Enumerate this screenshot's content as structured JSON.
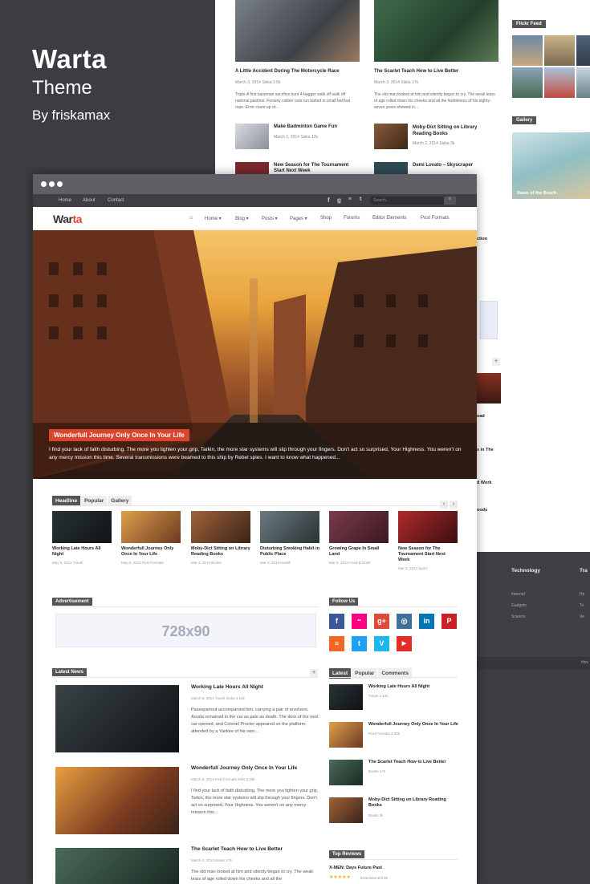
{
  "promo": {
    "name": "Warta",
    "subtitle": "Theme",
    "author": "By friskamax"
  },
  "back": {
    "posts_top": [
      {
        "title": "A Little Accident During The Motorcycle Race",
        "meta": "March 3, 2014   Siska   3   5k",
        "excerpt": "Triple-A first baseman sacrifice bunt 4-bagger walk off walk off national pastime. Fenway rubber outs run batted in small ball bat rope. Error count up of..."
      },
      {
        "title": "The Scarlet Teach How to Live Better",
        "meta": "March 3, 2014   Siska   17k",
        "excerpt": "The old man looked at him and silently began to cry. The weak tears of  age rolled down his cheeks and all the feebleness of his eighty-seven  years showed in..."
      }
    ],
    "posts_small": [
      {
        "title": "Make Badminton Game Fun",
        "meta": "March 2, 2014   Siska   12k"
      },
      {
        "title": "Moby-Dict Sitting on Library Reading Books",
        "meta": "March 2, 2014   Siska   3k"
      },
      {
        "title": "New Season for The Tournament Start Next Week",
        "meta": ""
      },
      {
        "title": "Demi Lovato – Skyscraper",
        "meta": ""
      }
    ],
    "flickr_title": "Flickr Feed",
    "gallery_title": "Gallery",
    "gallery_caption": "Dawn of the Beach",
    "fragments": [
      "ction",
      "oad",
      "s in The",
      "d Work",
      "oods"
    ],
    "footer_cols": [
      {
        "title": "Technology",
        "items": [
          "Internet",
          "Gadgets",
          "Science"
        ]
      },
      {
        "title": "Tra",
        "items": [
          "Ho",
          "To",
          "Ve"
        ]
      }
    ],
    "footer_copy": "Hov"
  },
  "topbar": {
    "links": [
      "Home",
      "About",
      "Contact"
    ],
    "search_placeholder": "Search..."
  },
  "nav": {
    "logo_a": "War",
    "logo_b": "ta",
    "home_icon": "home-icon",
    "items": [
      "Home ▾",
      "Blog ▾",
      "Posts ▾",
      "Pages ▾",
      "Shop",
      "Forums",
      "Editor Elements",
      "Post Formats"
    ]
  },
  "hero": {
    "title": "Wonderfull Journey Only Once In Your Life",
    "excerpt": "I find your lack of faith disturbing. The more you tighten your grip, Tarkin, the more star systems will slip through your fingers. Don't act so surprised, Your Highness. You weren't on any mercy mission this time. Several transmissions were beamed to this ship by Rebel spies. I want to know what happened..."
  },
  "headline": {
    "tabs": [
      "Headline",
      "Popular",
      "Gallery"
    ],
    "arrows": [
      "‹",
      "›"
    ],
    "cards": [
      {
        "title": "Working Late Hours All Night",
        "meta": "May 5, 2014   Travel"
      },
      {
        "title": "Wonderfull Journey Only Once In Your Life",
        "meta": "May 5, 2014   Post Formats"
      },
      {
        "title": "Moby-Dict Sitting on Library Reading Books",
        "meta": "Mar 2, 2014   Books"
      },
      {
        "title": "Disturbing Smoking Habit in Public Place",
        "meta": "Mar 3, 2014   Health"
      },
      {
        "title": "Growing Grape In Small Land",
        "meta": "Mar 3, 2014   Food & Drink"
      },
      {
        "title": "New Season for The Tournament Start Next Week",
        "meta": "Mar 2, 2014   Sport"
      }
    ]
  },
  "ad": {
    "title": "Advertisement",
    "label": "728x90"
  },
  "follow": {
    "title": "Follow Us",
    "icons": [
      "f",
      "••",
      "g+",
      "◎",
      "in",
      "P",
      "≡",
      "t",
      "V",
      "▶"
    ]
  },
  "latest_news": {
    "title": "Latest News",
    "plus": "+",
    "items": [
      {
        "title": "Working Late Hours All Night",
        "meta": "March 5, 2014   Travel   Siska   3   12k",
        "excerpt": "Passepartout accompanied him, carrying a pair of revolvers. Aouda remained in the car as pale as death. The door of the next car opened, and Colonel Proctor appeared on the platform, attended by a Yankee of his own..."
      },
      {
        "title": "Wonderfull Journey Only Once In Your Life",
        "meta": "March 5, 2014   Post Formats   Miss   3   20k",
        "excerpt": "I find your lack of faith disturbing. The more you tighten your grip, Tarkin, the more star systems will slip through your fingers. Don't act so surprised, Your Highness. You weren't on any mercy mission this..."
      },
      {
        "title": "The Scarlet Teach How to Live Better",
        "meta": "March 3, 2014   Books   17k",
        "excerpt": "The old man looked at him and silently began to cry. The weak tears of  age rolled down his cheeks and all the"
      }
    ]
  },
  "side_tabs": {
    "tabs": [
      "Latest",
      "Popular",
      "Comments"
    ],
    "items": [
      {
        "title": "Working Late Hours All Night",
        "meta": "Travel   3   12k"
      },
      {
        "title": "Wonderfull Journey Only Once In Your Life",
        "meta": "Post Formats   3   20k"
      },
      {
        "title": "The Scarlet Teach How to Live Better",
        "meta": "Books   17k"
      },
      {
        "title": "Moby-Dict Sitting on Library Reading Books",
        "meta": "Books   3k"
      }
    ]
  },
  "reviews": {
    "title": "Top Reviews",
    "item": "X-MEN: Days Future Past",
    "stars": "★★★★★",
    "meta": "Entertainment   9k"
  }
}
